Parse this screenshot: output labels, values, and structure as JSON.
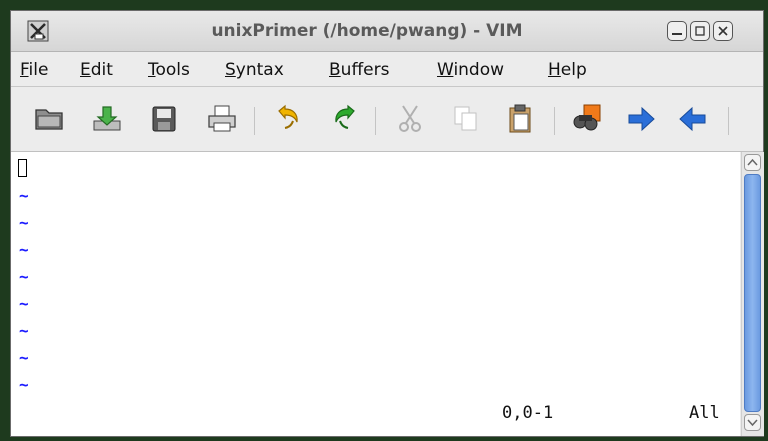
{
  "window": {
    "title": "unixPrimer (/home/pwang) - VIM",
    "app_icon": "vim-icon",
    "controls": [
      "minimize-icon",
      "maximize-icon",
      "close-icon"
    ]
  },
  "menubar": {
    "items": [
      {
        "first": "F",
        "rest": "ile"
      },
      {
        "first": "E",
        "rest": "dit"
      },
      {
        "first": "T",
        "rest": "ools"
      },
      {
        "first": "S",
        "rest": "yntax"
      },
      {
        "first": "B",
        "rest": "uffers"
      },
      {
        "first": "W",
        "rest": "indow"
      },
      {
        "first": "H",
        "rest": "elp"
      }
    ]
  },
  "toolbar": {
    "icons": [
      "open-icon",
      "save-icon",
      "save-all-icon",
      "print-icon",
      "undo-icon",
      "redo-icon",
      "cut-icon",
      "copy-icon",
      "paste-icon",
      "find-replace-icon",
      "forward-icon",
      "back-icon"
    ]
  },
  "editor": {
    "empty_line_marker": "~",
    "ruler_position": "0,0-1",
    "ruler_scroll": "All"
  },
  "colors": {
    "tilde": "#1a1aff",
    "scroll_thumb": "#7aa7e8",
    "undo_arrow": "#f0b400",
    "redo_arrow": "#2eaa2e",
    "nav_arrow": "#2a6ed8"
  }
}
